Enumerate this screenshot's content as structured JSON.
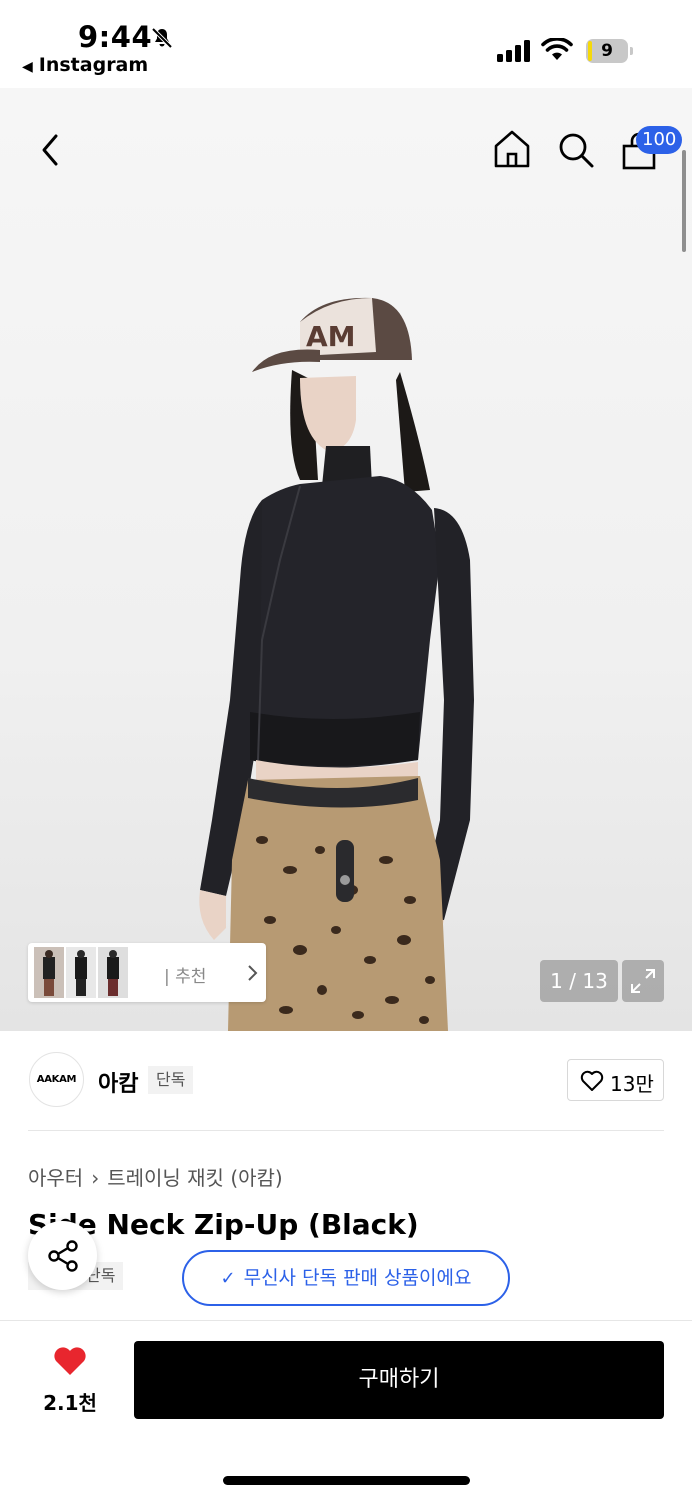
{
  "status_bar": {
    "time": "9:44",
    "back_app": "Instagram",
    "battery_level": "9",
    "battery_fraction": 0.09
  },
  "header": {
    "cart_badge": "100"
  },
  "gallery": {
    "recommend_label": "| 추천",
    "pager": "1 / 13"
  },
  "brand": {
    "logo_text": "AAKAM",
    "name": "아캄",
    "tag": "단독",
    "like_count": "13만"
  },
  "product": {
    "breadcrumb": [
      "아우터",
      "트레이닝 재킷 (아캄)"
    ],
    "breadcrumb_sep": "›",
    "title": "Side Neck Zip-Up (Black)",
    "sub_tag": "단독",
    "exclusive_note": "무신사 단독 판매 상품이에요"
  },
  "bottom_bar": {
    "wish_count": "2.1천",
    "buy_label": "구매하기"
  },
  "colors": {
    "accent_blue": "#2c61e8",
    "heart_red": "#e8262e",
    "battery_yellow": "#f5d90a"
  },
  "icons": [
    "bell-slash-icon",
    "cellular-signal-icon",
    "wifi-icon",
    "battery-icon",
    "back-chevron-icon",
    "home-icon",
    "search-icon",
    "shopping-bag-icon",
    "chevron-right-icon",
    "expand-icon",
    "heart-outline-icon",
    "share-icon",
    "check-icon",
    "heart-filled-icon"
  ]
}
